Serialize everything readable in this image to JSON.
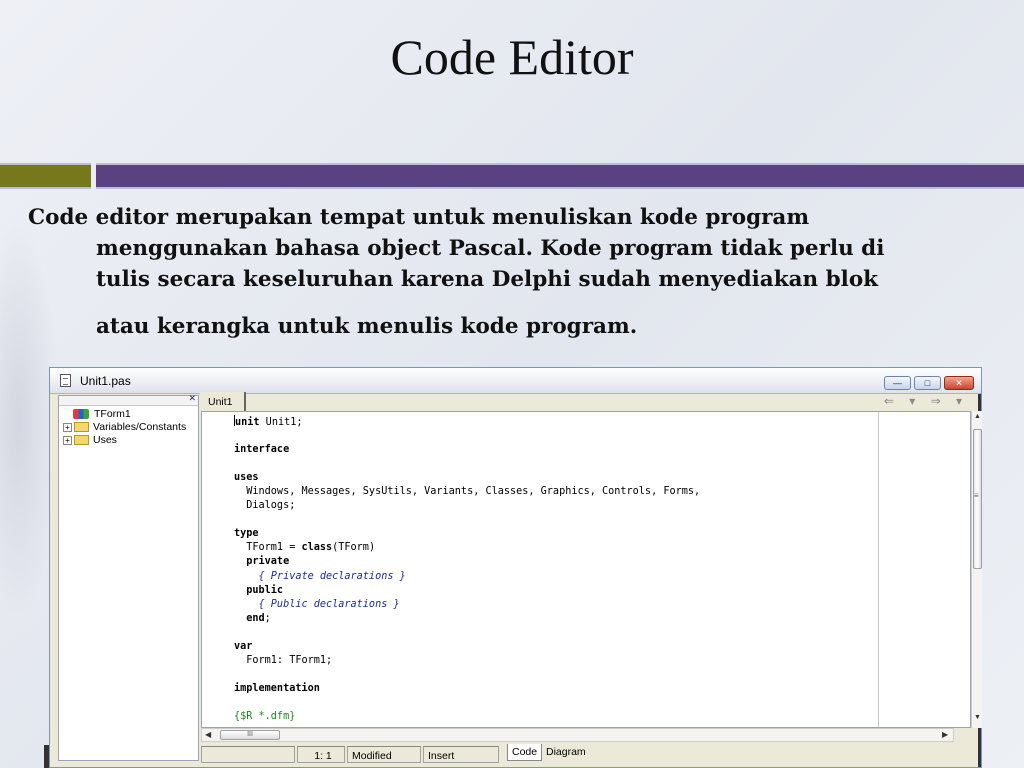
{
  "slide": {
    "title": "Code Editor",
    "paragraph": {
      "line1": "Code editor merupakan tempat untuk menuliskan kode program",
      "line2": "menggunakan bahasa object Pascal. Kode program tidak perlu di",
      "line3": "tulis secara keseluruhan karena Delphi sudah menyediakan blok",
      "line4": "atau kerangka untuk menulis kode program."
    },
    "colors": {
      "olive_bar": "#76781c",
      "purple_bar": "#5a4182"
    }
  },
  "ide": {
    "window_title": "Unit1.pas",
    "window_buttons": {
      "minimize": "—",
      "maximize": "□",
      "close": "✕"
    },
    "explorer": {
      "close_glyph": "✕",
      "items": [
        {
          "label": "TForm1",
          "type": "class"
        },
        {
          "label": "Variables/Constants",
          "type": "folder",
          "expand": "+"
        },
        {
          "label": "Uses",
          "type": "folder",
          "expand": "+"
        }
      ]
    },
    "tab": {
      "label": "Unit1"
    },
    "nav_arrows": "⇐ ▾ ⇒ ▾",
    "code_lines": [
      {
        "kind": "caret-text",
        "parts": [
          {
            "t": "unit",
            "c": "kw"
          },
          {
            "t": " Unit1;",
            "c": ""
          }
        ]
      },
      {
        "parts": []
      },
      {
        "parts": [
          {
            "t": "interface",
            "c": "kw"
          }
        ]
      },
      {
        "parts": []
      },
      {
        "parts": [
          {
            "t": "uses",
            "c": "kw"
          }
        ]
      },
      {
        "parts": [
          {
            "t": "  Windows, Messages, SysUtils, Variants, Classes, Graphics, Controls, Forms,",
            "c": ""
          }
        ]
      },
      {
        "parts": [
          {
            "t": "  Dialogs;",
            "c": ""
          }
        ]
      },
      {
        "parts": []
      },
      {
        "parts": [
          {
            "t": "type",
            "c": "kw"
          }
        ]
      },
      {
        "parts": [
          {
            "t": "  TForm1 = ",
            "c": ""
          },
          {
            "t": "class",
            "c": "kw"
          },
          {
            "t": "(TForm)",
            "c": ""
          }
        ]
      },
      {
        "parts": [
          {
            "t": "  private",
            "c": "kw"
          }
        ]
      },
      {
        "parts": [
          {
            "t": "    { Private declarations }",
            "c": "cm"
          }
        ]
      },
      {
        "parts": [
          {
            "t": "  public",
            "c": "kw"
          }
        ]
      },
      {
        "parts": [
          {
            "t": "    { Public declarations }",
            "c": "cm"
          }
        ]
      },
      {
        "parts": [
          {
            "t": "  end",
            "c": "kw"
          },
          {
            "t": ";",
            "c": ""
          }
        ]
      },
      {
        "parts": []
      },
      {
        "parts": [
          {
            "t": "var",
            "c": "kw"
          }
        ]
      },
      {
        "parts": [
          {
            "t": "  Form1: TForm1;",
            "c": ""
          }
        ]
      },
      {
        "parts": []
      },
      {
        "parts": [
          {
            "t": "implementation",
            "c": "kw"
          }
        ]
      },
      {
        "parts": []
      },
      {
        "parts": [
          {
            "t": "{$R *.dfm}",
            "c": "dir"
          }
        ]
      }
    ],
    "statusbar": {
      "position": "1:   1",
      "modified": "Modified",
      "insert_mode": "Insert",
      "tabs": [
        "Code",
        "Diagram"
      ]
    },
    "scroll": {
      "h_thumb_grip": "III",
      "v_grip": "≡",
      "up": "▲",
      "down": "▼",
      "left": "◀",
      "right": "▶"
    }
  }
}
